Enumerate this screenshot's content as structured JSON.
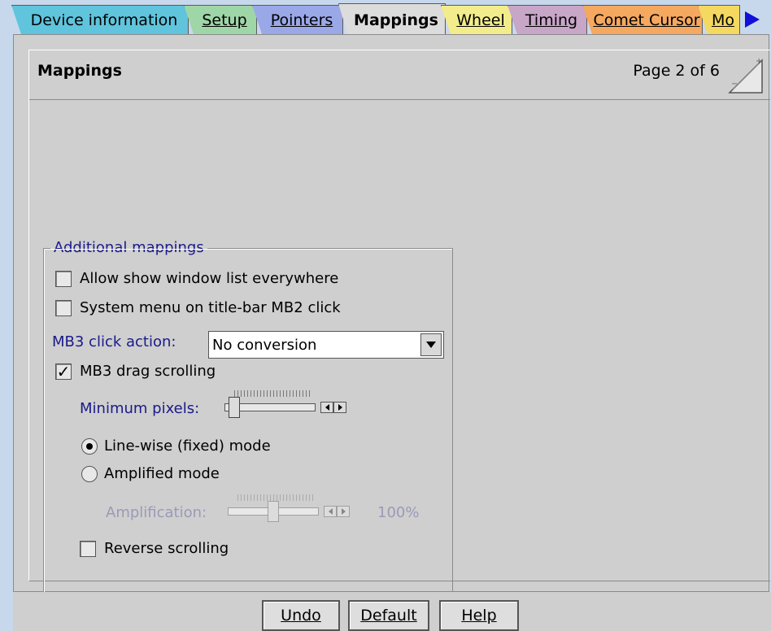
{
  "tabs": [
    {
      "label": "Device information",
      "underline": "i",
      "rest": "Device ",
      "after": "nformation",
      "color": "#5fc4dc"
    },
    {
      "label": "Setup",
      "color": "#9fd6a8"
    },
    {
      "label": "Pointers",
      "color": "#9aa8e8"
    },
    {
      "label": "Mappings",
      "color": "#dcdcdc"
    },
    {
      "label": "Wheel",
      "color": "#f2ec8c"
    },
    {
      "label": "Timing",
      "color": "#c8a6c8"
    },
    {
      "label": "Comet Cursor",
      "color": "#f4a860"
    },
    {
      "label": "Mo",
      "color": "#f4d860"
    }
  ],
  "page": {
    "title": "Mappings",
    "page_number": "Page 2 of 6"
  },
  "group": {
    "legend": "Additional mappings",
    "allow_show_window_list": {
      "label": "Allow show window list everywhere",
      "checked": false
    },
    "system_menu": {
      "label": "System menu on title-bar MB2 click",
      "checked": false
    },
    "mb3_click_label": "MB3 click action:",
    "mb3_click_value": "No conversion",
    "mb3_drag": {
      "label": "MB3 drag scrolling",
      "checked": true,
      "mark": "✓"
    },
    "minimum_pixels_label": "Minimum pixels:",
    "minimum_pixels_level": 0.05,
    "line_wise": {
      "label": "Line-wise (fixed) mode",
      "selected": true
    },
    "amplified": {
      "label": "Amplified mode",
      "selected": false
    },
    "amplification_label": "Amplification:",
    "amplification_value": "100%",
    "amplification_level": 0.5,
    "reverse_scrolling": {
      "label": "Reverse scrolling",
      "checked": false
    }
  },
  "buttons": {
    "undo": "Undo",
    "default": "Default",
    "help": "Help"
  },
  "icons": {
    "tab_scroll": "right-arrow-icon",
    "page_corner": "page-flip-icon"
  }
}
